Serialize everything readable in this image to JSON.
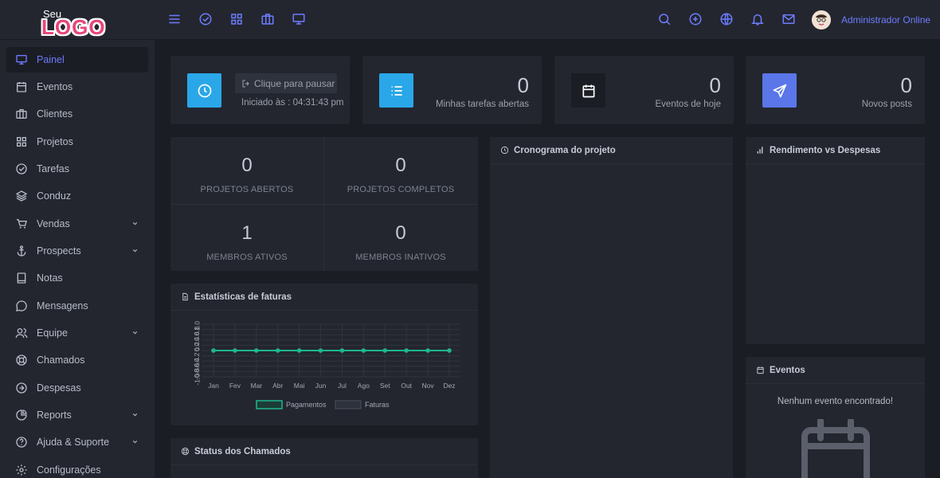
{
  "brand": {
    "logo_top": "Seu",
    "logo_main": "LOGO"
  },
  "topbar": {
    "left_icons": [
      "menu-icon",
      "check-circle-icon",
      "grid-icon",
      "briefcase-icon",
      "monitor-icon"
    ],
    "right_icons": [
      "search-icon",
      "plus-circle-icon",
      "globe-icon",
      "bell-icon",
      "mail-icon"
    ],
    "user_name": "Administrador Online"
  },
  "sidebar": {
    "items": [
      {
        "label": "Painel",
        "icon": "monitor-icon",
        "active": true,
        "has_submenu": false
      },
      {
        "label": "Eventos",
        "icon": "calendar-icon",
        "active": false,
        "has_submenu": false
      },
      {
        "label": "Clientes",
        "icon": "briefcase-icon",
        "active": false,
        "has_submenu": false
      },
      {
        "label": "Projetos",
        "icon": "grid-icon",
        "active": false,
        "has_submenu": false
      },
      {
        "label": "Tarefas",
        "icon": "check-circle-icon",
        "active": false,
        "has_submenu": false
      },
      {
        "label": "Conduz",
        "icon": "layers-icon",
        "active": false,
        "has_submenu": false
      },
      {
        "label": "Vendas",
        "icon": "cart-icon",
        "active": false,
        "has_submenu": true
      },
      {
        "label": "Prospects",
        "icon": "anchor-icon",
        "active": false,
        "has_submenu": true
      },
      {
        "label": "Notas",
        "icon": "book-icon",
        "active": false,
        "has_submenu": false
      },
      {
        "label": "Mensagens",
        "icon": "message-icon",
        "active": false,
        "has_submenu": false
      },
      {
        "label": "Equipe",
        "icon": "users-icon",
        "active": false,
        "has_submenu": true
      },
      {
        "label": "Chamados",
        "icon": "lifebuoy-icon",
        "active": false,
        "has_submenu": false
      },
      {
        "label": "Despesas",
        "icon": "arrow-circle-icon",
        "active": false,
        "has_submenu": false
      },
      {
        "label": "Reports",
        "icon": "pie-chart-icon",
        "active": false,
        "has_submenu": true
      },
      {
        "label": "Ajuda & Suporte",
        "icon": "help-circle-icon",
        "active": false,
        "has_submenu": true
      },
      {
        "label": "Configurações",
        "icon": "settings-icon",
        "active": false,
        "has_submenu": false
      }
    ]
  },
  "timer": {
    "pause_label": "Clique para pausar",
    "started_label": "Iniciado às : 04:31:43 pm",
    "icon": "clock-icon",
    "color": "#2aa7e8"
  },
  "summary": [
    {
      "value": "0",
      "label": "Minhas tarefas abertas",
      "icon": "list-icon",
      "color": "#2aa7e8"
    },
    {
      "value": "0",
      "label": "Eventos de hoje",
      "icon": "calendar-icon",
      "color": "#1b1d24"
    },
    {
      "value": "0",
      "label": "Novos posts",
      "icon": "send-icon",
      "color": "#5a76e8"
    }
  ],
  "project_stats": [
    {
      "value": "0",
      "label": "PROJETOS ABERTOS"
    },
    {
      "value": "0",
      "label": "PROJETOS COMPLETOS"
    },
    {
      "value": "1",
      "label": "MEMBROS ATIVOS"
    },
    {
      "value": "0",
      "label": "MEMBROS INATIVOS"
    }
  ],
  "panels": {
    "invoices": "Estatísticas de faturas",
    "tickets": "Status dos Chamados",
    "timeline": "Cronograma do projeto",
    "income": "Rendimento vs Despesas",
    "events": "Eventos",
    "events_empty": "Nenhum evento encontrado!"
  },
  "chart_data": {
    "type": "line",
    "categories": [
      "Jan",
      "Fev",
      "Mar",
      "Abr",
      "Mai",
      "Jun",
      "Jul",
      "Ago",
      "Set",
      "Out",
      "Nov",
      "Dez"
    ],
    "series": [
      {
        "name": "Pagamentos",
        "values": [
          0,
          0,
          0,
          0,
          0,
          0,
          0,
          0,
          0,
          0,
          0,
          0
        ],
        "color": "#1fb58f"
      },
      {
        "name": "Faturas",
        "values": [
          0,
          0,
          0,
          0,
          0,
          0,
          0,
          0,
          0,
          0,
          0,
          0
        ],
        "color": "#3a3f4b"
      }
    ],
    "y_ticks": [
      "1.0",
      "0.8",
      "0.6",
      "0.4",
      "0.2",
      "0",
      "-0.2",
      "-0.4",
      "-0.6",
      "-0.8",
      "-1.0"
    ],
    "ylim": [
      -1,
      1
    ],
    "grid": true,
    "legend": "bottom"
  }
}
